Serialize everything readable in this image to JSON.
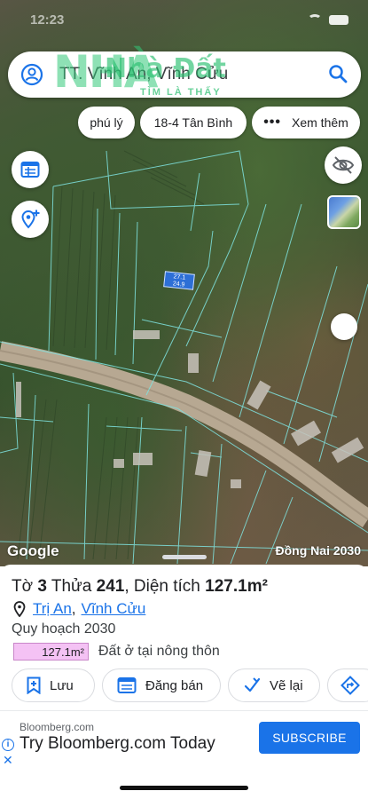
{
  "status_bar": {
    "time": "12:23"
  },
  "search": {
    "query": "TT. Vĩnh An, Vĩnh Cửu"
  },
  "watermark": {
    "big": "NHÀ",
    "brand": "Nhà Đất",
    "tagline": "TÌM LÀ THẤY"
  },
  "chips": [
    {
      "label": "phú lý"
    },
    {
      "label": "18-4 Tân Bình"
    },
    {
      "label": "Xem thêm",
      "icon": "more-dots-icon"
    }
  ],
  "map": {
    "google_label": "Google",
    "caption": "Đồng Nai 2030",
    "parcel_dims": {
      "width": "27.1",
      "depth": "24.9"
    }
  },
  "parcel": {
    "title_prefix": "Tờ",
    "sheet_no": "3",
    "plot_label": "Thửa",
    "plot_no": "241",
    "area_label": ", Diện tích",
    "area_value": "127.1m²",
    "location": {
      "ward": "Trị An",
      "district": "Vĩnh Cửu"
    },
    "plan_label": "Quy hoạch 2030",
    "area_badge": "127.1m²",
    "zone": "Đất ở tại nông thôn"
  },
  "actions": [
    {
      "label": "Lưu",
      "icon": "bookmark-plus-icon"
    },
    {
      "label": "Đăng bán",
      "icon": "listing-icon"
    },
    {
      "label": "Vẽ lại",
      "icon": "redraw-icon"
    },
    {
      "label": "",
      "icon": "directions-icon"
    }
  ],
  "ad": {
    "domain": "Bloomberg.com",
    "headline": "Try Bloomberg.com Today",
    "cta": "SUBSCRIBE",
    "info": "i",
    "close": "✕"
  },
  "colors": {
    "accent": "#1a73e8",
    "badge": "#f4c2f4",
    "parcel": "#2d6fd6",
    "white": "#ffffff"
  }
}
